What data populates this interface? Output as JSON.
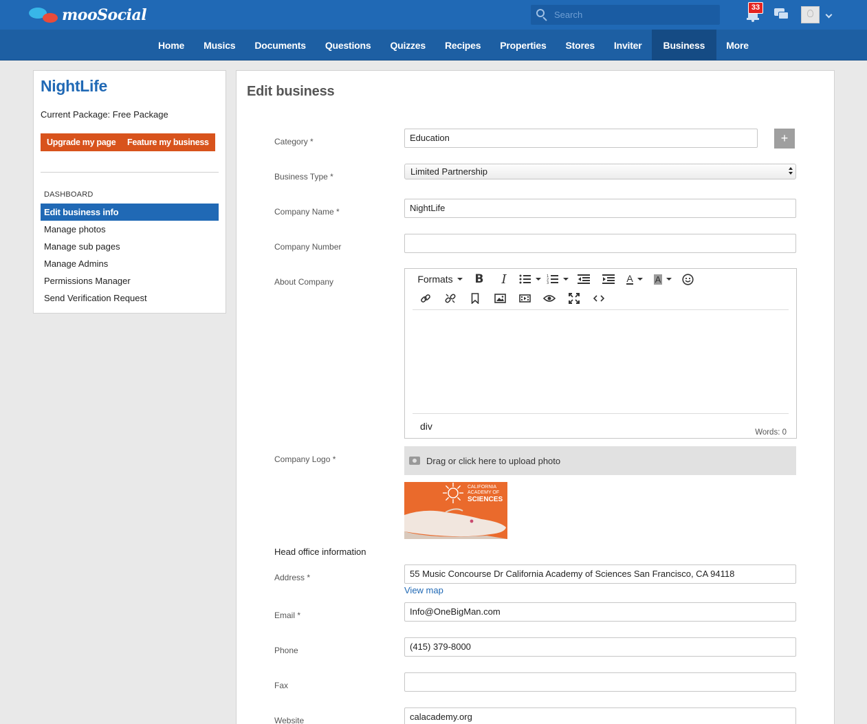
{
  "topbar": {
    "logo_text": "mooSocial",
    "search_placeholder": "Search",
    "notification_count": "33",
    "brand_color": "#2069b5"
  },
  "nav": {
    "items": [
      "Home",
      "Musics",
      "Documents",
      "Questions",
      "Quizzes",
      "Recipes",
      "Properties",
      "Stores",
      "Inviter",
      "Business",
      "More"
    ],
    "active": "Business"
  },
  "sidebar": {
    "business_name": "NightLife",
    "package_label": "Current Package: Free Package",
    "upgrade_button": "Upgrade my page",
    "feature_button": "Feature my business",
    "dashboard_title": "DASHBOARD",
    "menu": [
      "Edit business info",
      "Manage photos",
      "Manage sub pages",
      "Manage Admins",
      "Permissions Manager",
      "Send Verification Request"
    ],
    "accent_color": "#d8531c"
  },
  "form": {
    "title": "Edit business",
    "category": {
      "label": "Category *",
      "value": "Education",
      "add_button": "+"
    },
    "business_type": {
      "label": "Business Type *",
      "value": "Limited Partnership"
    },
    "company_name": {
      "label": "Company Name *",
      "value": "NightLife"
    },
    "company_number": {
      "label": "Company Number",
      "value": ""
    },
    "about": {
      "label": "About Company",
      "formats_label": "Formats",
      "path": "div",
      "words": "Words: 0"
    },
    "logo": {
      "label": "Company Logo *",
      "upload_text": "Drag or click here to upload photo",
      "image_text_small1": "CALIFORNIA",
      "image_text_small2": "ACADEMY OF",
      "image_text_big": "SCIENCES"
    },
    "head_office_title": "Head office information",
    "address": {
      "label": "Address *",
      "value": "55 Music Concourse Dr California Academy of Sciences San Francisco, CA 94118",
      "view_map": "View map"
    },
    "email": {
      "label": "Email *",
      "value": "Info@OneBigMan.com"
    },
    "phone": {
      "label": "Phone",
      "value": "(415) 379-8000"
    },
    "fax": {
      "label": "Fax",
      "value": ""
    },
    "website": {
      "label": "Website",
      "value": "calacademy.org"
    }
  }
}
